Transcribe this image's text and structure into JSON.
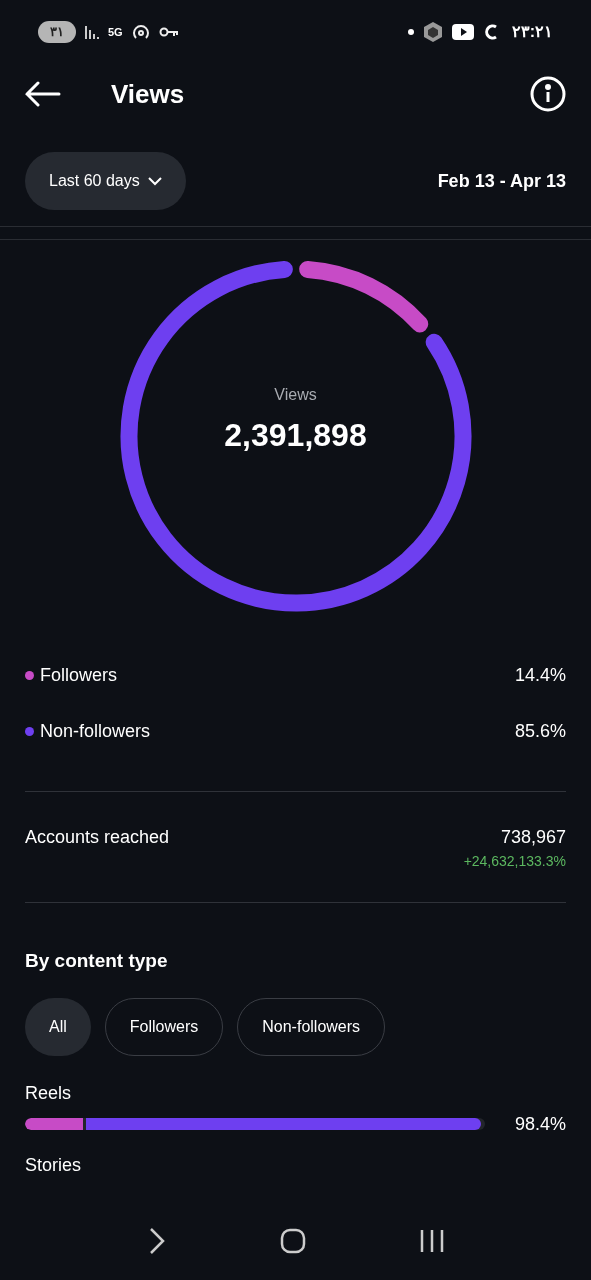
{
  "status_bar": {
    "battery": "۳۱",
    "network": "5G",
    "time": "۲۳:۲۱"
  },
  "header": {
    "title": "Views"
  },
  "filter": {
    "range": "Last 60 days",
    "dates": "Feb 13 - Apr 13"
  },
  "summary": {
    "label": "Views",
    "value": "2,391,898"
  },
  "legend": [
    {
      "label": "Followers",
      "value": "14.4%",
      "color": "#c74bc6"
    },
    {
      "label": "Non-followers",
      "value": "85.6%",
      "color": "#6e3ff0"
    }
  ],
  "accounts_reached": {
    "label": "Accounts reached",
    "value": "738,967",
    "change": "+24,632,133.3%"
  },
  "content_type": {
    "title": "By content type",
    "filters": [
      {
        "label": "All",
        "selected": true
      },
      {
        "label": "Followers",
        "selected": false
      },
      {
        "label": "Non-followers",
        "selected": false
      }
    ],
    "rows": [
      {
        "label": "Reels",
        "value": "98.4%",
        "segments": [
          {
            "level": 0.126,
            "color": "#c74bc6"
          },
          {
            "level": 0.858,
            "color": "#6e3ff0"
          }
        ]
      },
      {
        "label": "Stories"
      }
    ]
  }
}
